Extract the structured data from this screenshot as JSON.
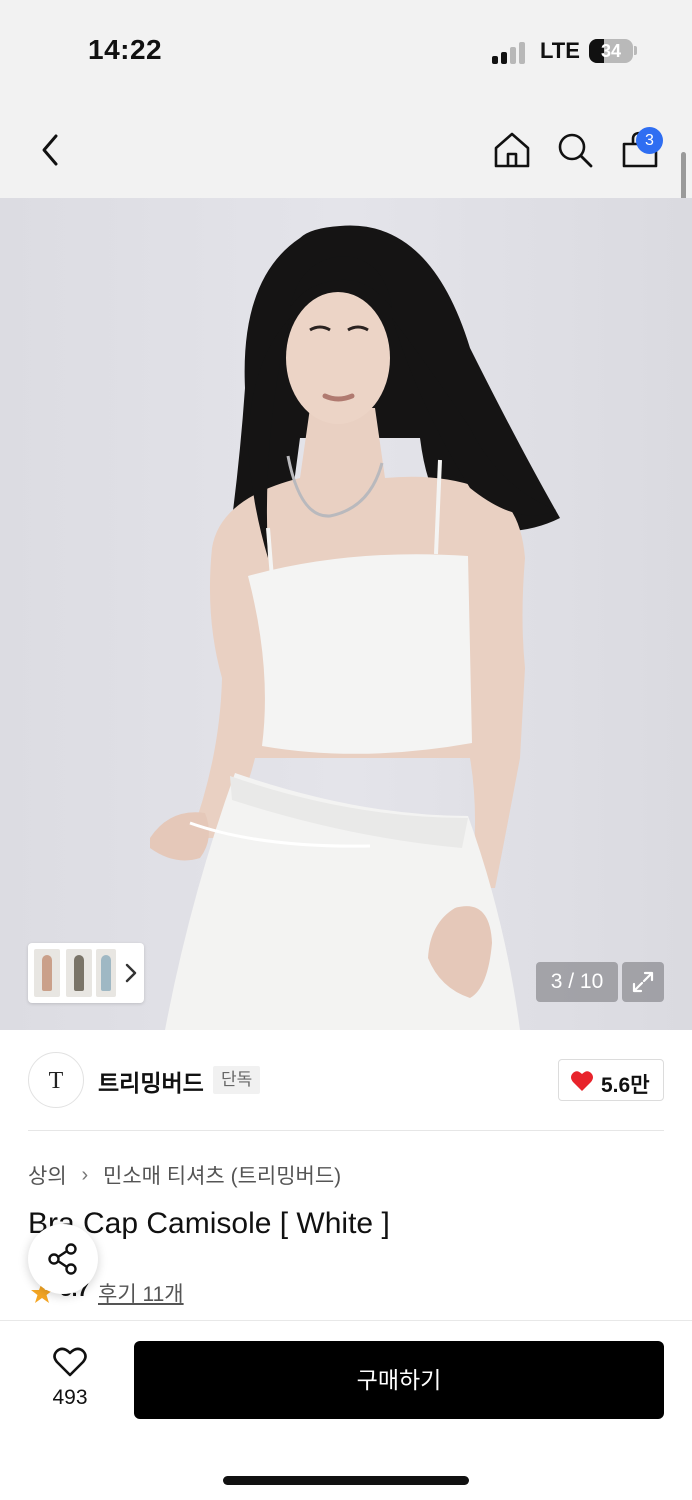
{
  "status_bar": {
    "time": "14:22",
    "network": "LTE",
    "battery": "34",
    "battery_level": 0.34
  },
  "nav": {
    "back_icon": "chevron-left-icon",
    "home_icon": "home-icon",
    "search_icon": "search-icon",
    "cart_icon": "shopping-bag-icon",
    "cart_count": "3"
  },
  "gallery": {
    "counter": "3 / 10",
    "current": 3,
    "total": 10,
    "thumb_arrow": "chevron-right-icon",
    "expand_icon": "expand-icon"
  },
  "brand": {
    "logo_text": "T",
    "name": "트리밍버드",
    "tag": "단독",
    "likes": "5.6만"
  },
  "breadcrumb": {
    "category": "상의",
    "subcategory": "민소매 티셔츠 (트리밍버드)"
  },
  "product": {
    "title": "Bra Cap Camisole [ White ]",
    "rating": "3.7",
    "reviews": "후기 11개"
  },
  "actions": {
    "wishlist_count": "493",
    "buy_label": "구매하기"
  },
  "colors": {
    "accent_badge": "#2f6ef2",
    "heart": "#e8232b",
    "star": "#f5a623",
    "buy_button": "#000000"
  }
}
